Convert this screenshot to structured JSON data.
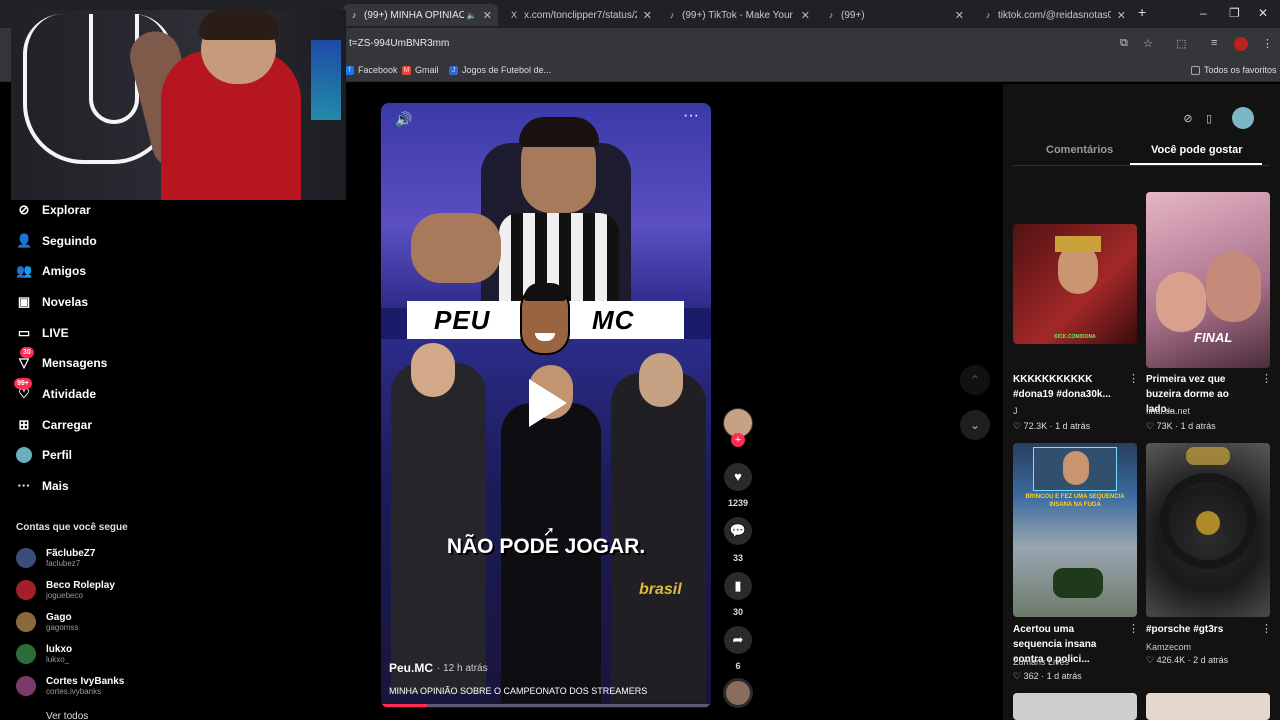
{
  "browser": {
    "tabs": [
      {
        "label": "(99+) MINHA OPINIÃO SO",
        "active": true,
        "icon": "tiktok-icon"
      },
      {
        "label": "x.com/tonclipper7/status/209",
        "active": false,
        "icon": "x-icon"
      },
      {
        "label": "(99+) TikTok - Make Your Day",
        "active": false,
        "icon": "tiktok-icon"
      },
      {
        "label": "(99+)",
        "active": false,
        "icon": "tiktok-icon"
      },
      {
        "label": "tiktok.com/@reidasnotas007/",
        "active": false,
        "icon": "tiktok-icon"
      }
    ],
    "url": "t=ZS-994UmBNR3mm",
    "bookmarks": [
      "Facebook",
      "Gmail",
      "Jogos de Futebol de..."
    ],
    "all_bookmarks": "Todos os favoritos"
  },
  "nav": {
    "items": [
      {
        "label": "Explorar",
        "icon": "compass-icon"
      },
      {
        "label": "Seguindo",
        "icon": "following-icon"
      },
      {
        "label": "Amigos",
        "icon": "friends-icon"
      },
      {
        "label": "Novelas",
        "icon": "novelas-icon"
      },
      {
        "label": "LIVE",
        "icon": "live-icon"
      },
      {
        "label": "Mensagens",
        "icon": "messages-icon",
        "badge": "30"
      },
      {
        "label": "Atividade",
        "icon": "activity-icon",
        "badge": "99+"
      },
      {
        "label": "Carregar",
        "icon": "upload-icon"
      },
      {
        "label": "Perfil",
        "icon": "profile-icon"
      },
      {
        "label": "Mais",
        "icon": "more-icon"
      }
    ],
    "following_title": "Contas que você segue",
    "accounts": [
      {
        "name": "FãclubeZ7",
        "handle": "faclubez7",
        "color": "#3b4d7a"
      },
      {
        "name": "Beco Roleplay",
        "handle": "joguebeco",
        "color": "#a3202a"
      },
      {
        "name": "Gago",
        "handle": "gagomss",
        "color": "#8a6a3a"
      },
      {
        "name": "lukxo",
        "handle": "lukxo_",
        "color": "#2c6e3a"
      },
      {
        "name": "Cortes IvyBanks",
        "handle": "cortes.ivybanks",
        "color": "#7a3a6a"
      }
    ],
    "see_all": "Ver todos"
  },
  "video": {
    "banner_left": "PEU",
    "banner_right": "MC",
    "caption": "NÃO PODE JOGAR.",
    "overlay_text": "brasil",
    "author": "Peu.MC",
    "time": "· 12 h atrás",
    "description": "MINHA OPINIÃO SOBRE O CAMPEONATO DOS STREAMERS",
    "progress": 0.14
  },
  "actions": {
    "likes": "1239",
    "comments": "33",
    "saves": "30",
    "shares": "6"
  },
  "right_panel": {
    "tabs": [
      "Comentários",
      "Você pode gostar"
    ],
    "active_tab": 1,
    "cards": [
      {
        "title": "KKKKKKKKKKK #dona19 #dona30k...",
        "author": "J",
        "likes": "72.3K",
        "date": "1 d atrás",
        "thumb_text": "KICK.COM/DONA",
        "color": "#7a1d1d"
      },
      {
        "title": "Primeira vez que buzeira dorme ao lado...",
        "author": "final.da.net",
        "likes": "73K",
        "date": "1 d atrás",
        "thumb_text": "FINAL",
        "color": "#b87a93"
      },
      {
        "title": "Acertou uma sequencia insana contra o polici...",
        "author": "Zumans Lives",
        "likes": "362",
        "date": "1 d atrás",
        "thumb_text": "BRINCOU E FEZ UMA SEQUENCIA INSANA NA FUGA",
        "color": "#5d7fa8"
      },
      {
        "title": "#porsche #gt3rs",
        "author": "Kamzecom",
        "likes": "426.4K",
        "date": "2 d atrás",
        "thumb_text": "",
        "color": "#3a3a3a"
      }
    ]
  }
}
